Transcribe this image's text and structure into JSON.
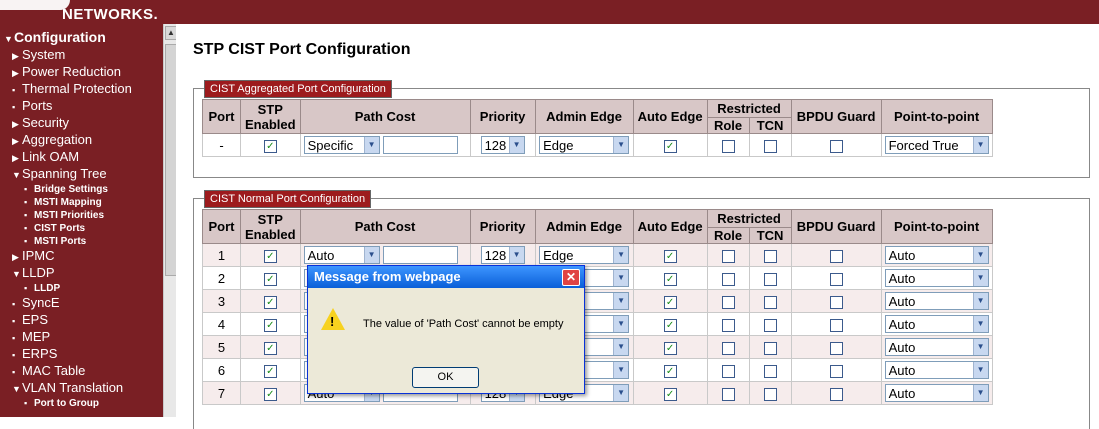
{
  "header": {
    "logo_text": "NETWORKS."
  },
  "sidebar": {
    "items": [
      {
        "label": "Configuration",
        "level": "top",
        "mark": "▼"
      },
      {
        "label": "System",
        "level": "l1",
        "mark": "▶"
      },
      {
        "label": "Power Reduction",
        "level": "l1",
        "mark": "▶"
      },
      {
        "label": "Thermal Protection",
        "level": "l1",
        "mark": "▪"
      },
      {
        "label": "Ports",
        "level": "l1",
        "mark": "▪"
      },
      {
        "label": "Security",
        "level": "l1",
        "mark": "▶"
      },
      {
        "label": "Aggregation",
        "level": "l1",
        "mark": "▶"
      },
      {
        "label": "Link OAM",
        "level": "l1",
        "mark": "▶"
      },
      {
        "label": "Spanning Tree",
        "level": "l1",
        "mark": "▼"
      },
      {
        "label": "Bridge Settings",
        "level": "l2",
        "mark": "▪"
      },
      {
        "label": "MSTI Mapping",
        "level": "l2",
        "mark": "▪"
      },
      {
        "label": "MSTI Priorities",
        "level": "l2",
        "mark": "▪"
      },
      {
        "label": "CIST Ports",
        "level": "l2",
        "mark": "▪"
      },
      {
        "label": "MSTI Ports",
        "level": "l2",
        "mark": "▪"
      },
      {
        "label": "IPMC",
        "level": "l1",
        "mark": "▶"
      },
      {
        "label": "LLDP",
        "level": "l1",
        "mark": "▼"
      },
      {
        "label": "LLDP",
        "level": "l2",
        "mark": "▪"
      },
      {
        "label": "SyncE",
        "level": "l1",
        "mark": "▪"
      },
      {
        "label": "EPS",
        "level": "l1",
        "mark": "▪"
      },
      {
        "label": "MEP",
        "level": "l1",
        "mark": "▪"
      },
      {
        "label": "ERPS",
        "level": "l1",
        "mark": "▪"
      },
      {
        "label": "MAC Table",
        "level": "l1",
        "mark": "▪"
      },
      {
        "label": "VLAN Translation",
        "level": "l1",
        "mark": "▼"
      },
      {
        "label": "Port to Group",
        "level": "l2",
        "mark": "▪"
      }
    ]
  },
  "page": {
    "title": "STP CIST Port Configuration"
  },
  "headers": {
    "port": "Port",
    "stp_enabled": "STP Enabled",
    "path_cost": "Path Cost",
    "priority": "Priority",
    "admin_edge": "Admin Edge",
    "auto_edge": "Auto Edge",
    "restricted": "Restricted",
    "role": "Role",
    "tcn": "TCN",
    "bpdu_guard": "BPDU Guard",
    "p2p": "Point-to-point"
  },
  "aggregated": {
    "legend": "CIST Aggregated Port Configuration",
    "row": {
      "port": "-",
      "stp": "✓",
      "path_cost": "Specific",
      "priority": "128",
      "admin_edge": "Edge",
      "auto_edge": "✓",
      "role": "",
      "tcn": "",
      "bpdu": "",
      "p2p": "Forced True"
    }
  },
  "normal": {
    "legend": "CIST Normal Port Configuration",
    "rows": [
      {
        "port": "1",
        "stp": "✓",
        "path_cost": "Auto",
        "priority": "128",
        "admin_edge": "Edge",
        "auto_edge": "✓",
        "p2p": "Auto"
      },
      {
        "port": "2",
        "stp": "✓",
        "path_cost": "",
        "priority": "",
        "admin_edge": "dge",
        "auto_edge": "✓",
        "p2p": "Auto"
      },
      {
        "port": "3",
        "stp": "✓",
        "path_cost": "",
        "priority": "",
        "admin_edge": "dge",
        "auto_edge": "✓",
        "p2p": "Auto"
      },
      {
        "port": "4",
        "stp": "✓",
        "path_cost": "",
        "priority": "",
        "admin_edge": "dge",
        "auto_edge": "✓",
        "p2p": "Auto"
      },
      {
        "port": "5",
        "stp": "✓",
        "path_cost": "",
        "priority": "",
        "admin_edge": "dge",
        "auto_edge": "✓",
        "p2p": "Auto"
      },
      {
        "port": "6",
        "stp": "✓",
        "path_cost": "",
        "priority": "",
        "admin_edge": "dge",
        "auto_edge": "✓",
        "p2p": "Auto"
      },
      {
        "port": "7",
        "stp": "✓",
        "path_cost": "Auto",
        "priority": "128",
        "admin_edge": "Edge",
        "auto_edge": "✓",
        "p2p": "Auto"
      }
    ]
  },
  "dialog": {
    "title": "Message from webpage",
    "message": "The value of 'Path Cost' cannot be empty",
    "ok_label": "OK",
    "close_glyph": "✕",
    "icon_glyph": "!"
  }
}
